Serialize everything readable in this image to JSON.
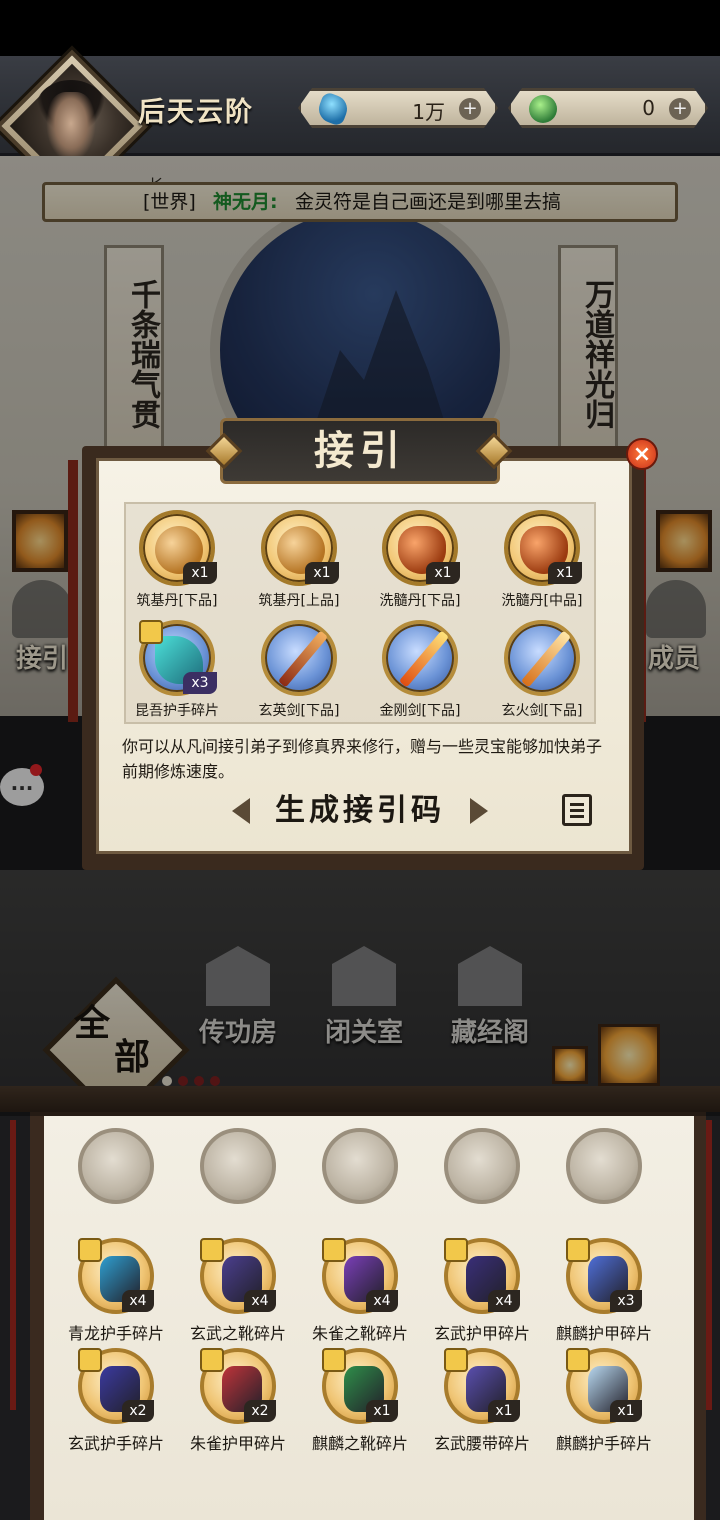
{
  "header": {
    "realm": "后天云阶",
    "currency": [
      {
        "name": "spirit-stone",
        "value": "1万",
        "plus": "+"
      },
      {
        "name": "jade",
        "value": "0",
        "plus": "+"
      }
    ]
  },
  "world_chat": {
    "channel": "[世界]",
    "sender": "神无月:",
    "message": "金灵符是自己画还是到哪里去搞"
  },
  "scene": {
    "partial_name": "长",
    "couplet_left": "千条瑞气贯",
    "couplet_right": "万道祥光归",
    "side_left": "接引",
    "side_right": "成员",
    "chat_bubble": "..."
  },
  "modal": {
    "title": "接引",
    "close": "×",
    "rewards": [
      {
        "name": "筑基丹[下品]",
        "count": "x1",
        "icon": "pill-icon"
      },
      {
        "name": "筑基丹[上品]",
        "count": "x1",
        "icon": "pill-icon"
      },
      {
        "name": "洗髓丹[下品]",
        "count": "x1",
        "icon": "bowl-icon"
      },
      {
        "name": "洗髓丹[中品]",
        "count": "x1",
        "icon": "bowl-icon"
      },
      {
        "name": "昆吾护手碎片",
        "count": "x3",
        "icon": "armor-fragment-icon"
      },
      {
        "name": "玄英剑[下品]",
        "count": "",
        "icon": "sword-icon"
      },
      {
        "name": "金刚剑[下品]",
        "count": "",
        "icon": "sword-icon"
      },
      {
        "name": "玄火剑[下品]",
        "count": "",
        "icon": "sword-icon"
      }
    ],
    "description": "你可以从凡间接引弟子到修真界来修行，赠与一些灵宝能够加快弟子前期修炼速度。",
    "button": "生成接引码"
  },
  "rooms": {
    "tab_all": [
      "全",
      "部"
    ],
    "items": [
      "传功房",
      "闭关室",
      "藏经阁"
    ]
  },
  "bag": {
    "empty_slots": 5,
    "items": [
      {
        "name": "青龙护手碎片",
        "count": "x4"
      },
      {
        "name": "玄武之靴碎片",
        "count": "x4"
      },
      {
        "name": "朱雀之靴碎片",
        "count": "x4"
      },
      {
        "name": "玄武护甲碎片",
        "count": "x4"
      },
      {
        "name": "麒麟护甲碎片",
        "count": "x3"
      },
      {
        "name": "玄武护手碎片",
        "count": "x2"
      },
      {
        "name": "朱雀护甲碎片",
        "count": "x2"
      },
      {
        "name": "麒麟之靴碎片",
        "count": "x1"
      },
      {
        "name": "玄武腰带碎片",
        "count": "x1"
      },
      {
        "name": "麒麟护手碎片",
        "count": "x1"
      }
    ]
  }
}
